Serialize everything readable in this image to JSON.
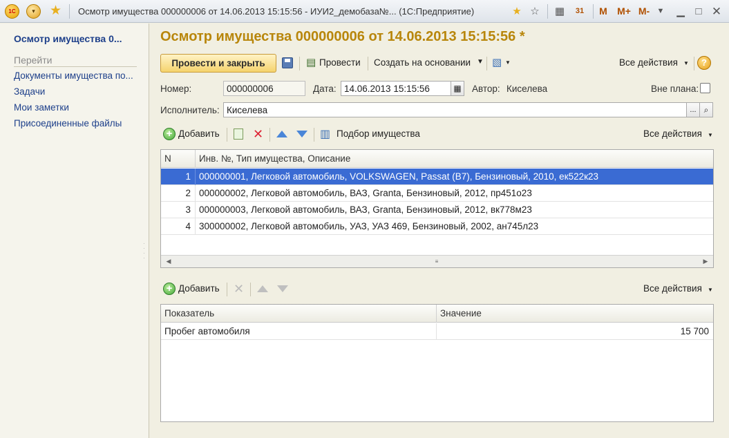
{
  "window": {
    "title": "Осмотр имущества 000000006 от 14.06.2013 15:15:56 - ИУИ2_демобаза№...  (1С:Предприятие)",
    "m_labels": [
      "M",
      "M+",
      "M-"
    ]
  },
  "sidebar": {
    "title": "Осмотр имущества 0...",
    "section": "Перейти",
    "items": [
      "Документы имущества по...",
      "Задачи",
      "Мои заметки",
      "Присоединенные файлы"
    ]
  },
  "document": {
    "title": "Осмотр имущества 000000006 от 14.06.2013 15:15:56 *"
  },
  "toolbar": {
    "post_close": "Провести и закрыть",
    "post": "Провести",
    "create_based": "Создать на основании",
    "all_actions": "Все действия"
  },
  "form": {
    "number_label": "Номер:",
    "number_value": "000000006",
    "date_label": "Дата:",
    "date_value": "14.06.2013 15:15:56",
    "author_label": "Автор:",
    "author_value": "Киселева",
    "offplan_label": "Вне плана:",
    "executor_label": "Исполнитель:",
    "executor_value": "Киселева",
    "ellipsis": "..."
  },
  "property_table": {
    "add": "Добавить",
    "selection": "Подбор имущества",
    "all_actions": "Все действия",
    "columns": [
      "N",
      "Инв. №, Тип имущества, Описание"
    ],
    "rows": [
      {
        "n": "1",
        "desc": "000000001, Легковой автомобиль, VOLKSWAGEN, Passat (B7), Бензиновый, 2010, ек522к23"
      },
      {
        "n": "2",
        "desc": "000000002, Легковой автомобиль, ВАЗ, Granta, Бензиновый, 2012, пр451о23"
      },
      {
        "n": "3",
        "desc": "000000003, Легковой автомобиль, ВАЗ, Granta, Бензиновый, 2012, вк778м23"
      },
      {
        "n": "4",
        "desc": "300000002, Легковой автомобиль, УАЗ, УАЗ 469, Бензиновый, 2002, ан745л23"
      }
    ]
  },
  "indicator_table": {
    "add": "Добавить",
    "all_actions": "Все действия",
    "columns": [
      "Показатель",
      "Значение"
    ],
    "rows": [
      {
        "name": "Пробег автомобиля",
        "value": "15 700"
      }
    ]
  },
  "colors": {
    "title_gold": "#b8860b",
    "link_blue": "#1d3f8a",
    "selection_blue": "#3a6bd3"
  }
}
